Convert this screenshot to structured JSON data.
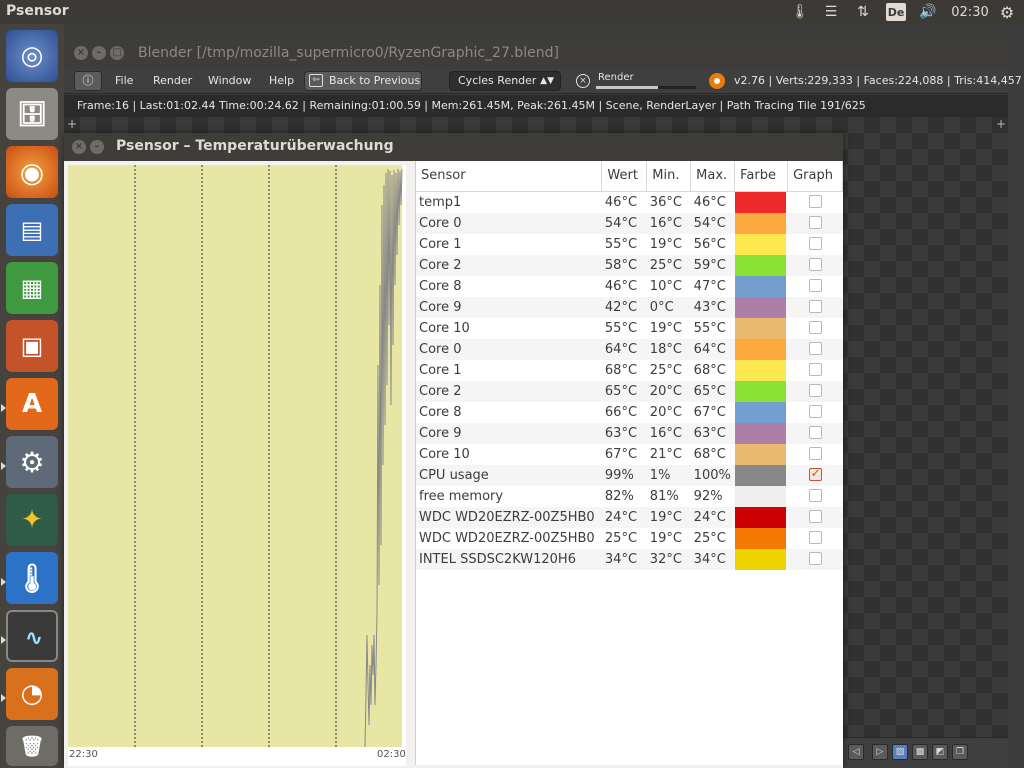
{
  "top_panel": {
    "app_name": "Psensor",
    "keyboard_layout": "De",
    "clock": "02:30",
    "icons": [
      "thermometer-icon",
      "list-icon",
      "network-arrows-icon",
      "keyboard-layout-icon",
      "volume-icon",
      "gear-icon"
    ]
  },
  "launcher": {
    "items": [
      "ubuntu-dash-icon",
      "files-icon",
      "firefox-icon",
      "writer-icon",
      "calc-icon",
      "impress-icon",
      "software-center-icon",
      "system-settings-icon",
      "app-icon",
      "psensor-icon",
      "system-monitor-icon",
      "blender-icon",
      "trash-icon"
    ]
  },
  "blender": {
    "title": "Blender [/tmp/mozilla_supermicro0/RyzenGraphic_27.blend]",
    "menu": {
      "file": "File",
      "render": "Render",
      "window": "Window",
      "help": "Help"
    },
    "back_label": "Back to Previous",
    "engine": "Cycles Render",
    "render_label": "Render",
    "render_progress": 0.62,
    "stats": "v2.76 | Verts:229,333 | Faces:224,088 | Tris:414,457",
    "render_info": "Frame:16 | Last:01:02.44 Time:00:24.62 | Remaining:01:00.59 | Mem:261.45M, Peak:261.45M | Scene, RenderLayer | Path Tracing Tile 191/625"
  },
  "psensor": {
    "title": "Psensor – Temperaturüberwachung",
    "graph": {
      "start_time": "22:30",
      "end_time": "02:30",
      "background": "#e8e6a4"
    },
    "columns": {
      "sensor": "Sensor",
      "value": "Wert",
      "min": "Min.",
      "max": "Max.",
      "color": "Farbe",
      "graph": "Graph"
    },
    "sensors": [
      {
        "name": "temp1",
        "value": "46°C",
        "min": "36°C",
        "max": "46°C",
        "color": "#ee2a2a",
        "graph": false
      },
      {
        "name": "Core 0",
        "value": "54°C",
        "min": "16°C",
        "max": "54°C",
        "color": "#fcaa3e",
        "graph": false
      },
      {
        "name": "Core 1",
        "value": "55°C",
        "min": "19°C",
        "max": "56°C",
        "color": "#fbe94f",
        "graph": false
      },
      {
        "name": "Core 2",
        "value": "58°C",
        "min": "25°C",
        "max": "59°C",
        "color": "#8ae234",
        "graph": false
      },
      {
        "name": "Core 8",
        "value": "46°C",
        "min": "10°C",
        "max": "47°C",
        "color": "#729fcf",
        "graph": false
      },
      {
        "name": "Core 9",
        "value": "42°C",
        "min": "0°C",
        "max": "43°C",
        "color": "#ad7fa8",
        "graph": false
      },
      {
        "name": "Core 10",
        "value": "55°C",
        "min": "19°C",
        "max": "55°C",
        "color": "#e9b96e",
        "graph": false
      },
      {
        "name": "Core 0",
        "value": "64°C",
        "min": "18°C",
        "max": "64°C",
        "color": "#fcaa3e",
        "graph": false
      },
      {
        "name": "Core 1",
        "value": "68°C",
        "min": "25°C",
        "max": "68°C",
        "color": "#fbe94f",
        "graph": false
      },
      {
        "name": "Core 2",
        "value": "65°C",
        "min": "20°C",
        "max": "65°C",
        "color": "#8ae234",
        "graph": false
      },
      {
        "name": "Core 8",
        "value": "66°C",
        "min": "20°C",
        "max": "67°C",
        "color": "#729fcf",
        "graph": false
      },
      {
        "name": "Core 9",
        "value": "63°C",
        "min": "16°C",
        "max": "63°C",
        "color": "#ad7fa8",
        "graph": false
      },
      {
        "name": "Core 10",
        "value": "67°C",
        "min": "21°C",
        "max": "68°C",
        "color": "#e9b96e",
        "graph": false
      },
      {
        "name": "CPU usage",
        "value": "99%",
        "min": "1%",
        "max": "100%",
        "color": "#888888",
        "graph": true
      },
      {
        "name": "free memory",
        "value": "82%",
        "min": "81%",
        "max": "92%",
        "color": "#eeeeec",
        "graph": false
      },
      {
        "name": "WDC WD20EZRZ-00Z5HB0",
        "value": "24°C",
        "min": "19°C",
        "max": "24°C",
        "color": "#cc0000",
        "graph": false
      },
      {
        "name": "WDC WD20EZRZ-00Z5HB0",
        "value": "25°C",
        "min": "19°C",
        "max": "25°C",
        "color": "#f57900",
        "graph": false
      },
      {
        "name": "INTEL SSDSC2KW120H6",
        "value": "34°C",
        "min": "32°C",
        "max": "34°C",
        "color": "#edd400",
        "graph": false
      }
    ]
  }
}
